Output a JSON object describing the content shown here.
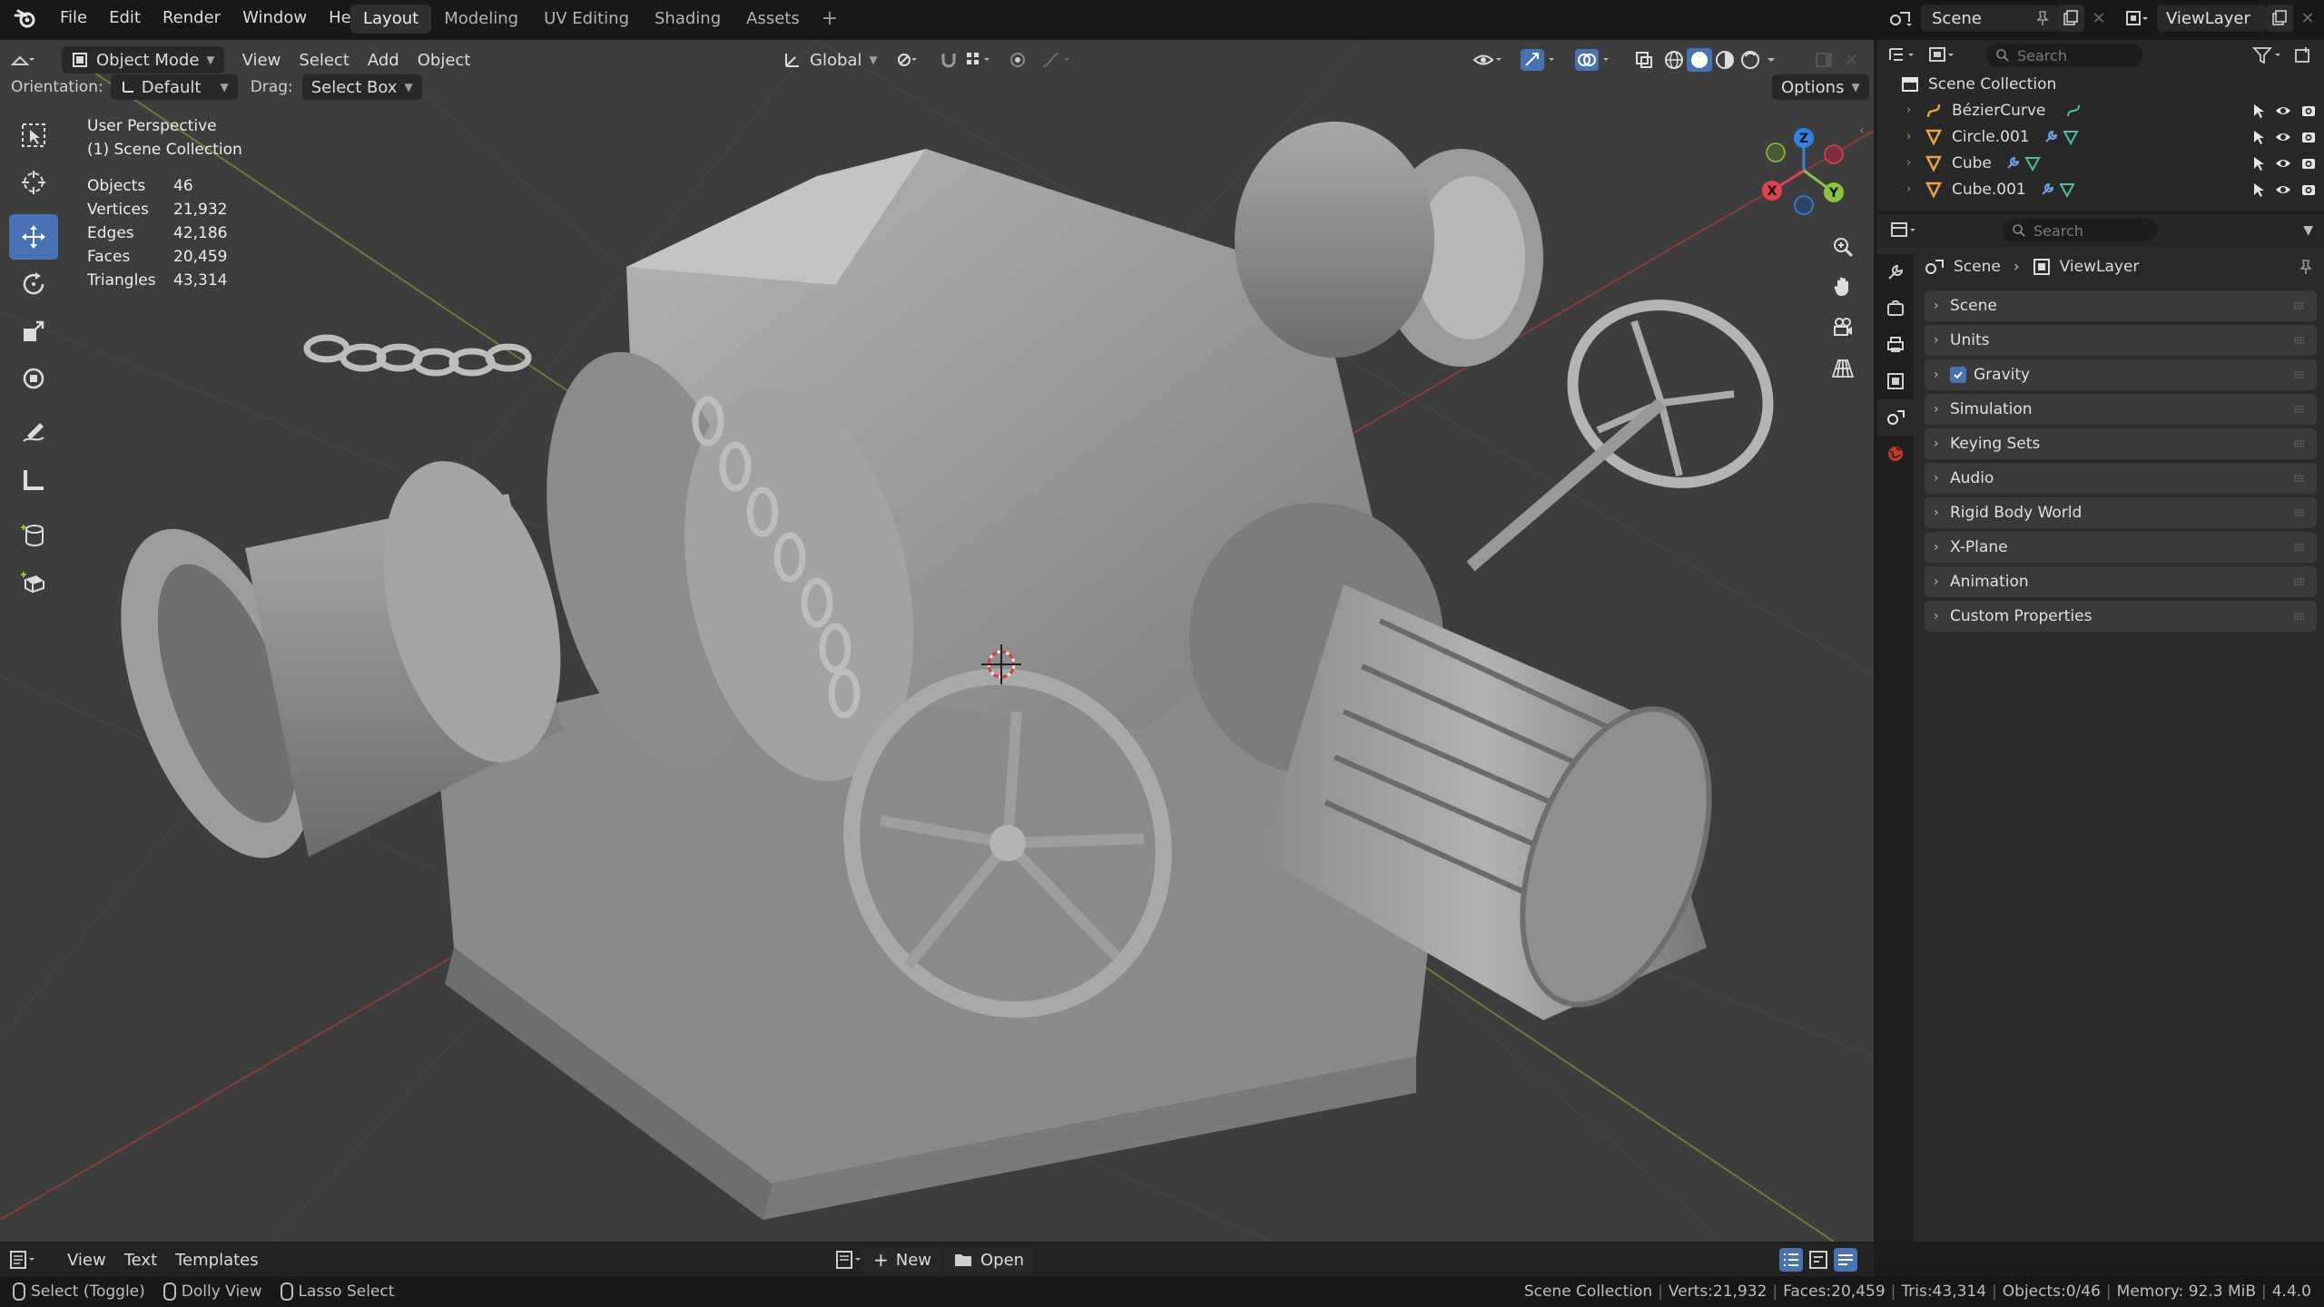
{
  "app": {
    "menu": [
      "File",
      "Edit",
      "Render",
      "Window",
      "Help"
    ],
    "workspace_tabs": [
      "Layout",
      "Modeling",
      "UV Editing",
      "Shading",
      "Assets"
    ],
    "active_tab": "Layout",
    "scene_name": "Scene",
    "view_layer_name": "ViewLayer"
  },
  "viewport": {
    "mode": "Object Mode",
    "menus": [
      "View",
      "Select",
      "Add",
      "Object"
    ],
    "transform_orientation": "Global",
    "orientation_label": "Orientation:",
    "orientation_value": "Default",
    "drag_label": "Drag:",
    "drag_value": "Select Box",
    "options_label": "Options",
    "overlay_title": "User Perspective",
    "overlay_subtitle": "(1) Scene Collection",
    "stats": [
      {
        "label": "Objects",
        "value": "46"
      },
      {
        "label": "Vertices",
        "value": "21,932"
      },
      {
        "label": "Edges",
        "value": "42,186"
      },
      {
        "label": "Faces",
        "value": "20,459"
      },
      {
        "label": "Triangles",
        "value": "43,314"
      }
    ],
    "gizmo_axes": {
      "x": "X",
      "y": "Y",
      "z": "Z"
    },
    "colors": {
      "x_axis": "#e0434f",
      "y_axis": "#8bc33a",
      "z_axis": "#2f84e3",
      "background": "#3d3d3d",
      "active_tool": "#4772b3"
    }
  },
  "toolbar": [
    "select-box-tool",
    "cursor-tool",
    "move-tool",
    "rotate-tool",
    "scale-tool",
    "transform-tool",
    "annotate-tool",
    "measure-tool",
    "add-cube-tool",
    "extrude-tool"
  ],
  "outliner": {
    "search_placeholder": "Search",
    "root": "Scene Collection",
    "items": [
      {
        "name": "BézierCurve",
        "type": "curve"
      },
      {
        "name": "Circle.001",
        "type": "mesh"
      },
      {
        "name": "Cube",
        "type": "mesh"
      },
      {
        "name": "Cube.001",
        "type": "mesh"
      }
    ]
  },
  "properties": {
    "search_placeholder": "Search",
    "breadcrumb": [
      "Scene",
      "ViewLayer"
    ],
    "panels": [
      {
        "label": "Scene",
        "checkbox": false
      },
      {
        "label": "Units",
        "checkbox": false
      },
      {
        "label": "Gravity",
        "checkbox": true
      },
      {
        "label": "Simulation",
        "checkbox": false
      },
      {
        "label": "Keying Sets",
        "checkbox": false
      },
      {
        "label": "Audio",
        "checkbox": false
      },
      {
        "label": "Rigid Body World",
        "checkbox": false
      },
      {
        "label": "X-Plane",
        "checkbox": false
      },
      {
        "label": "Animation",
        "checkbox": false
      },
      {
        "label": "Custom Properties",
        "checkbox": false
      }
    ]
  },
  "text_editor_header": {
    "menus": [
      "View",
      "Text",
      "Templates"
    ],
    "new_label": "New",
    "open_label": "Open"
  },
  "statusbar": {
    "select": "Select (Toggle)",
    "dolly": "Dolly View",
    "lasso": "Lasso Select",
    "collection": "Scene Collection",
    "verts": "Verts:21,932",
    "faces": "Faces:20,459",
    "tris": "Tris:43,314",
    "objects": "Objects:0/46",
    "memory": "Memory: 92.3 MiB",
    "version": "4.4.0"
  }
}
